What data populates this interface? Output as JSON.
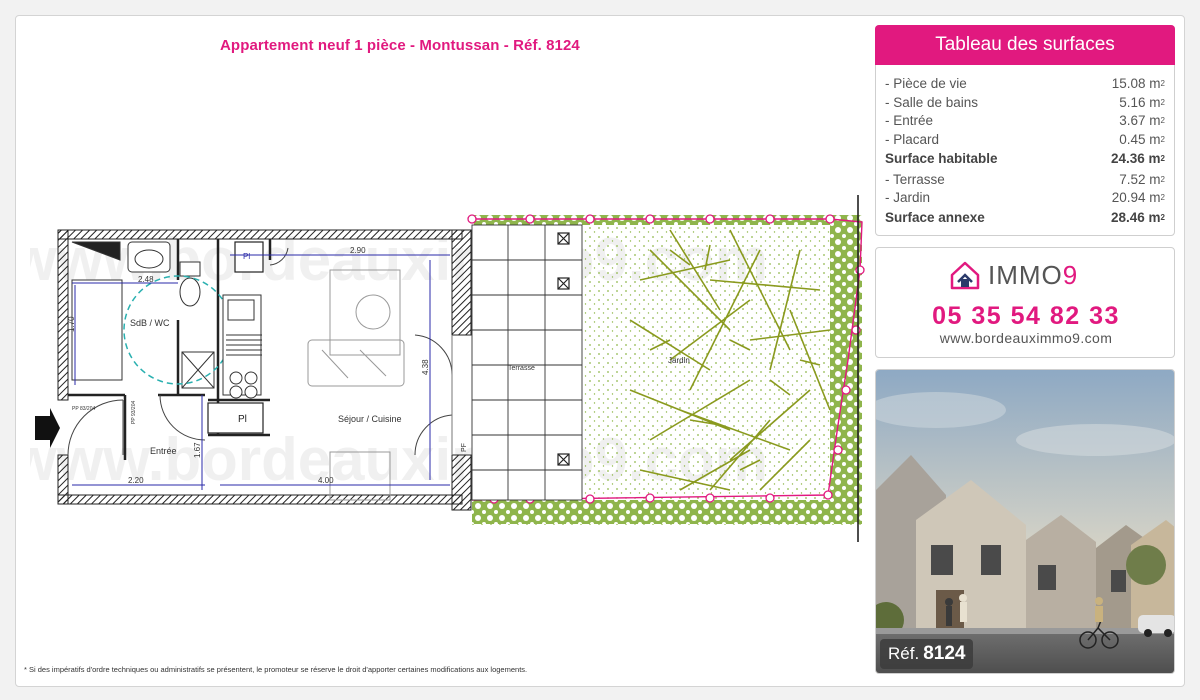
{
  "header": {
    "title": "Appartement neuf 1 pièce - Montussan - Réf. 8124"
  },
  "plan": {
    "rooms": {
      "sdb": "SdB / WC",
      "entree": "Entrée",
      "sejour": "Séjour / Cuisine",
      "terrasse": "Terrasse",
      "jardin": "Jardin",
      "pl1": "Pl",
      "pl2": "Pl"
    },
    "dimensions": {
      "d1": "2.48",
      "d2": "2.90",
      "d3": "1.70",
      "d4": "1.67",
      "d5": "2.20",
      "d6": "4.00",
      "d7": "4.38"
    },
    "small_labels": {
      "pp1": "PP 83/204",
      "pp2": "PP 93/204",
      "pf": "PF"
    }
  },
  "surfaces": {
    "heading": "Tableau des surfaces",
    "rows": [
      {
        "label": "- Pièce de vie",
        "value": "15.08 m",
        "bold": false
      },
      {
        "label": "- Salle de bains",
        "value": "5.16 m",
        "bold": false
      },
      {
        "label": "- Entrée",
        "value": "3.67 m",
        "bold": false
      },
      {
        "label": "- Placard",
        "value": "0.45 m",
        "bold": false
      },
      {
        "label": "Surface habitable",
        "value": "24.36 m",
        "bold": true
      },
      {
        "label": "- Terrasse",
        "value": "7.52 m",
        "bold": false
      },
      {
        "label": "- Jardin",
        "value": "20.94 m",
        "bold": false
      },
      {
        "label": "Surface annexe",
        "value": "28.46 m",
        "bold": true
      }
    ],
    "unit_sup": "2"
  },
  "contact": {
    "logo_text": "IMMO",
    "logo_num": "9",
    "phone": "05 35 54 82 33",
    "website": "www.bordeauximmo9.com"
  },
  "photo": {
    "ref_label": "Réf.",
    "ref_number": "8124"
  },
  "footer": {
    "note": "* Si des impératifs d'ordre techniques ou administratifs se présentent, le promoteur se réserve le droit d'apporter certaines modifications aux logements."
  },
  "colors": {
    "accent": "#e1197f",
    "dimension_blue": "#2a2aa8",
    "teal": "#2ab0b0",
    "grass": "#7fae3c",
    "tree": "#8a9a1e"
  }
}
